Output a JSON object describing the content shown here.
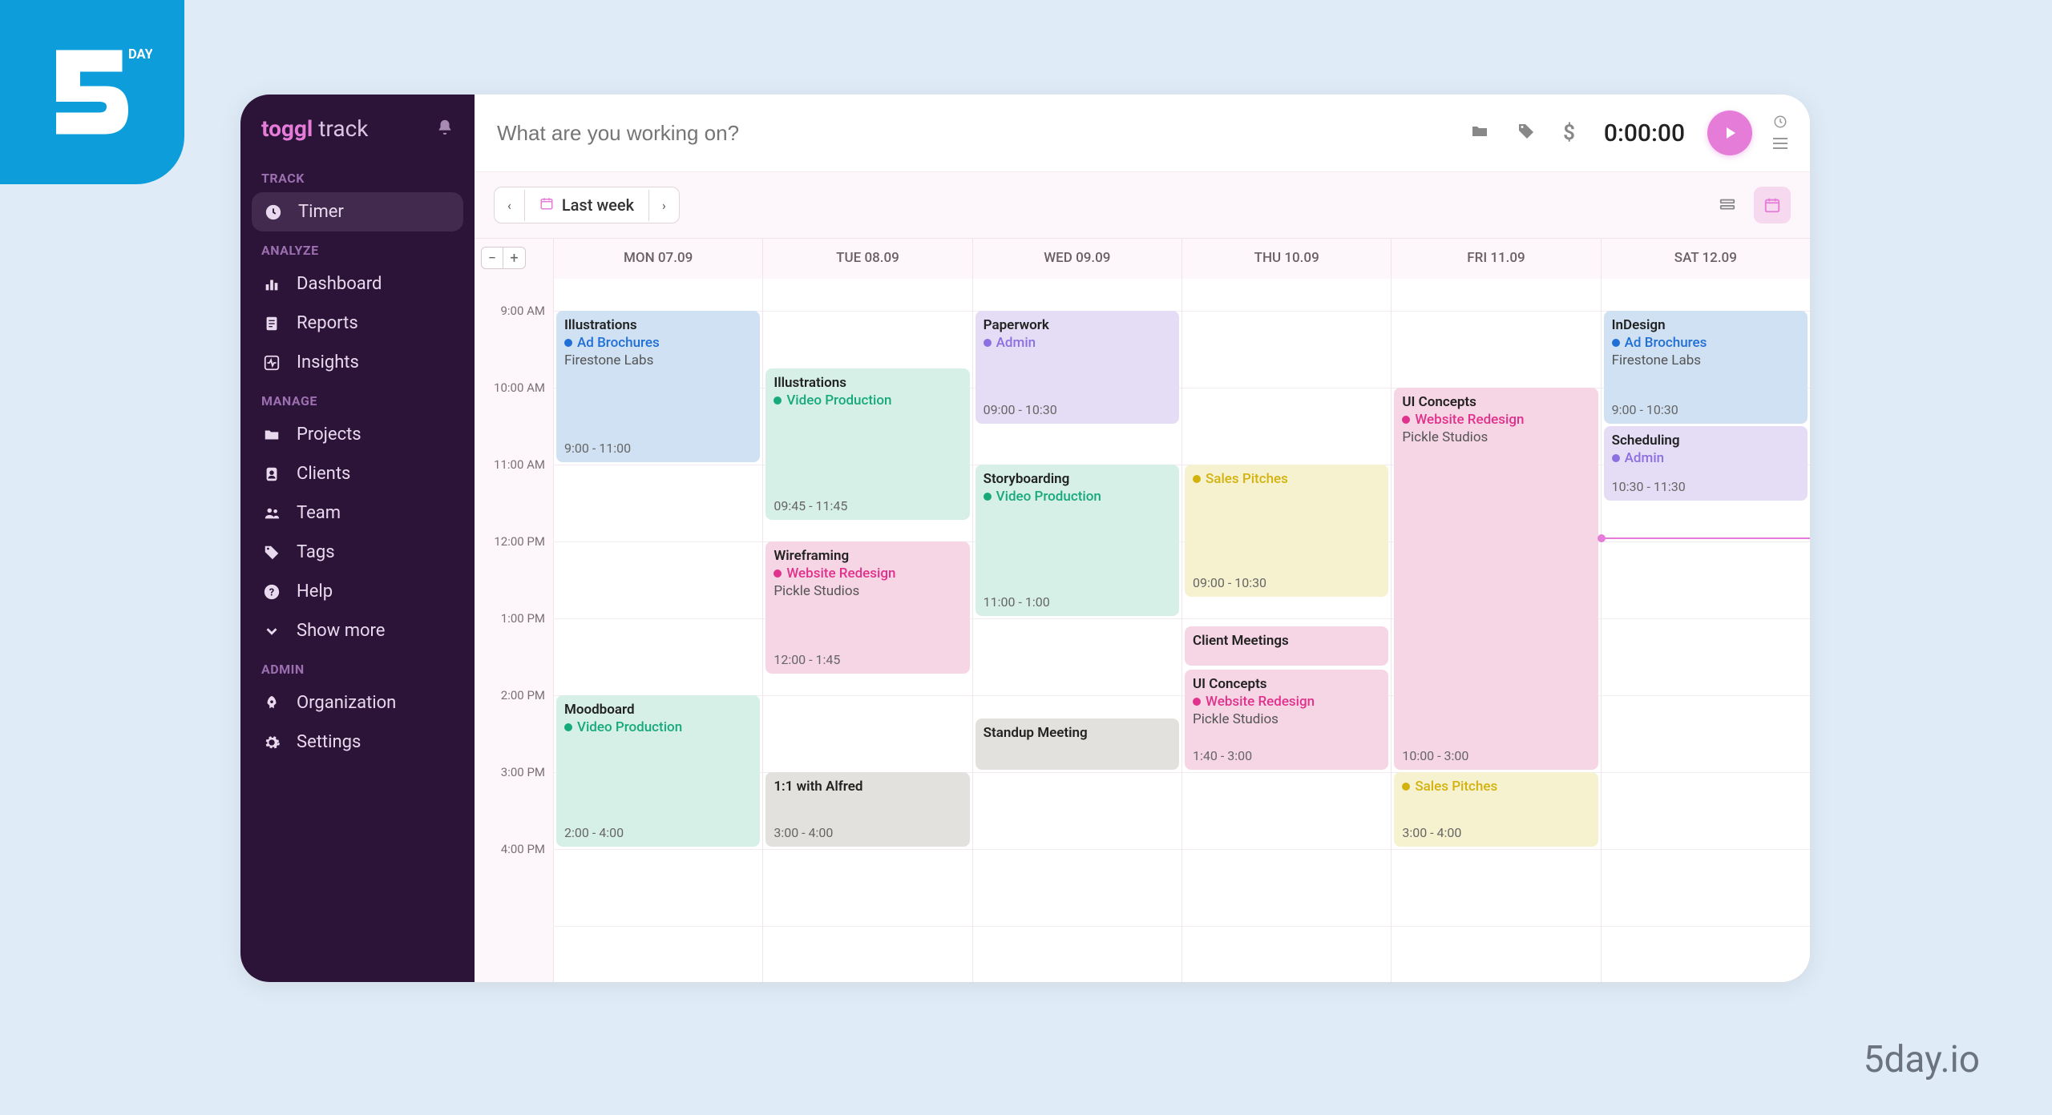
{
  "brand": {
    "badge": "5 DAY",
    "footer": "5day.io"
  },
  "logo": {
    "main": "toggl",
    "suffix": " track"
  },
  "sidebar": {
    "sections": [
      {
        "label": "TRACK",
        "items": [
          {
            "label": "Timer",
            "icon": "clock-icon",
            "active": true
          }
        ]
      },
      {
        "label": "ANALYZE",
        "items": [
          {
            "label": "Dashboard",
            "icon": "bar-chart-icon"
          },
          {
            "label": "Reports",
            "icon": "document-icon"
          },
          {
            "label": "Insights",
            "icon": "pulse-icon"
          }
        ]
      },
      {
        "label": "MANAGE",
        "items": [
          {
            "label": "Projects",
            "icon": "folder-icon"
          },
          {
            "label": "Clients",
            "icon": "person-icon"
          },
          {
            "label": "Team",
            "icon": "team-icon"
          },
          {
            "label": "Tags",
            "icon": "tag-icon"
          },
          {
            "label": "Help",
            "icon": "help-icon"
          },
          {
            "label": "Show more",
            "icon": "chevron-down-icon"
          }
        ]
      },
      {
        "label": "ADMIN",
        "items": [
          {
            "label": "Organization",
            "icon": "rocket-icon"
          },
          {
            "label": "Settings",
            "icon": "gear-icon"
          }
        ]
      }
    ]
  },
  "topbar": {
    "placeholder": "What are you working on?",
    "timer": "0:00:00"
  },
  "toolbar": {
    "range": "Last week"
  },
  "calendar": {
    "days": [
      "MON 07.09",
      "TUE 08.09",
      "WED 09.09",
      "THU 10.09",
      "FRI 11.09",
      "SAT 12.09"
    ],
    "hours": [
      "9:00 AM",
      "10:00 AM",
      "11:00 AM",
      "12:00 PM",
      "1:00 PM",
      "2:00 PM",
      "3:00 PM",
      "4:00 PM"
    ],
    "hour_start": 9,
    "now_hour": 11.95,
    "colors": {
      "ad_brochures": "#1f6fd6",
      "video_production": "#16a97a",
      "admin": "#8c6fe0",
      "website_redesign": "#e0318c",
      "sales_pitches": "#d4b20d"
    },
    "bg": {
      "blue": "#cfe1f2",
      "teal": "#d7f0e7",
      "purple": "#e4ddf5",
      "pink": "#f6d6e4",
      "yellow": "#f6f2cf",
      "grey": "#e3e1dd"
    },
    "events": [
      {
        "day": 0,
        "start": 9.0,
        "end": 11.0,
        "title": "Illustrations",
        "project": "Ad Brochures",
        "proj_color": "ad_brochures",
        "client": "Firestone Labs",
        "time": "9:00 - 11:00",
        "bg": "blue"
      },
      {
        "day": 0,
        "start": 14.0,
        "end": 16.0,
        "title": "Moodboard",
        "project": "Video Production",
        "proj_color": "video_production",
        "client": "",
        "time": "2:00 - 4:00",
        "bg": "teal"
      },
      {
        "day": 1,
        "start": 9.75,
        "end": 11.75,
        "title": "Illustrations",
        "project": "Video Production",
        "proj_color": "video_production",
        "client": "",
        "time": "09:45 - 11:45",
        "bg": "teal"
      },
      {
        "day": 1,
        "start": 12.0,
        "end": 13.75,
        "title": "Wireframing",
        "project": "Website Redesign",
        "proj_color": "website_redesign",
        "client": "Pickle Studios",
        "time": "12:00 - 1:45",
        "bg": "pink"
      },
      {
        "day": 1,
        "start": 15.0,
        "end": 16.0,
        "title": "1:1 with Alfred",
        "project": "",
        "proj_color": "",
        "client": "",
        "time": "3:00 - 4:00",
        "bg": "grey"
      },
      {
        "day": 2,
        "start": 9.0,
        "end": 10.5,
        "title": "Paperwork",
        "project": "Admin",
        "proj_color": "admin",
        "client": "",
        "time": "09:00 - 10:30",
        "bg": "purple"
      },
      {
        "day": 2,
        "start": 11.0,
        "end": 13.0,
        "title": "Storyboarding",
        "project": "Video Production",
        "proj_color": "video_production",
        "client": "",
        "time": "11:00 - 1:00",
        "bg": "teal"
      },
      {
        "day": 2,
        "start": 14.3,
        "end": 15.0,
        "title": "Standup Meeting",
        "project": "",
        "proj_color": "",
        "client": "",
        "time": "",
        "bg": "grey"
      },
      {
        "day": 3,
        "start": 11.0,
        "end": 12.75,
        "title": "",
        "project": "Sales Pitches",
        "proj_color": "sales_pitches",
        "client": "",
        "time": "09:00 - 10:30",
        "bg": "yellow"
      },
      {
        "day": 3,
        "start": 13.1,
        "end": 13.65,
        "title": "Client Meetings",
        "project": "",
        "proj_color": "",
        "client": "",
        "time": "",
        "bg": "pink"
      },
      {
        "day": 3,
        "start": 13.67,
        "end": 15.0,
        "title": "UI Concepts",
        "project": "Website Redesign",
        "proj_color": "website_redesign",
        "client": "Pickle Studios",
        "time": "1:40 - 3:00",
        "bg": "pink"
      },
      {
        "day": 4,
        "start": 10.0,
        "end": 15.0,
        "title": "UI Concepts",
        "project": "Website Redesign",
        "proj_color": "website_redesign",
        "client": "Pickle Studios",
        "time": "10:00 - 3:00",
        "bg": "pink"
      },
      {
        "day": 4,
        "start": 15.0,
        "end": 16.0,
        "title": "",
        "project": "Sales Pitches",
        "proj_color": "sales_pitches",
        "client": "",
        "time": "3:00 - 4:00",
        "bg": "yellow"
      },
      {
        "day": 5,
        "start": 9.0,
        "end": 10.5,
        "title": "InDesign",
        "project": "Ad Brochures",
        "proj_color": "ad_brochures",
        "client": "Firestone Labs",
        "time": "9:00 - 10:30",
        "bg": "blue"
      },
      {
        "day": 5,
        "start": 10.5,
        "end": 11.5,
        "title": "Scheduling",
        "project": "Admin",
        "proj_color": "admin",
        "client": "",
        "time": "10:30 - 11:30",
        "bg": "purple"
      }
    ]
  }
}
